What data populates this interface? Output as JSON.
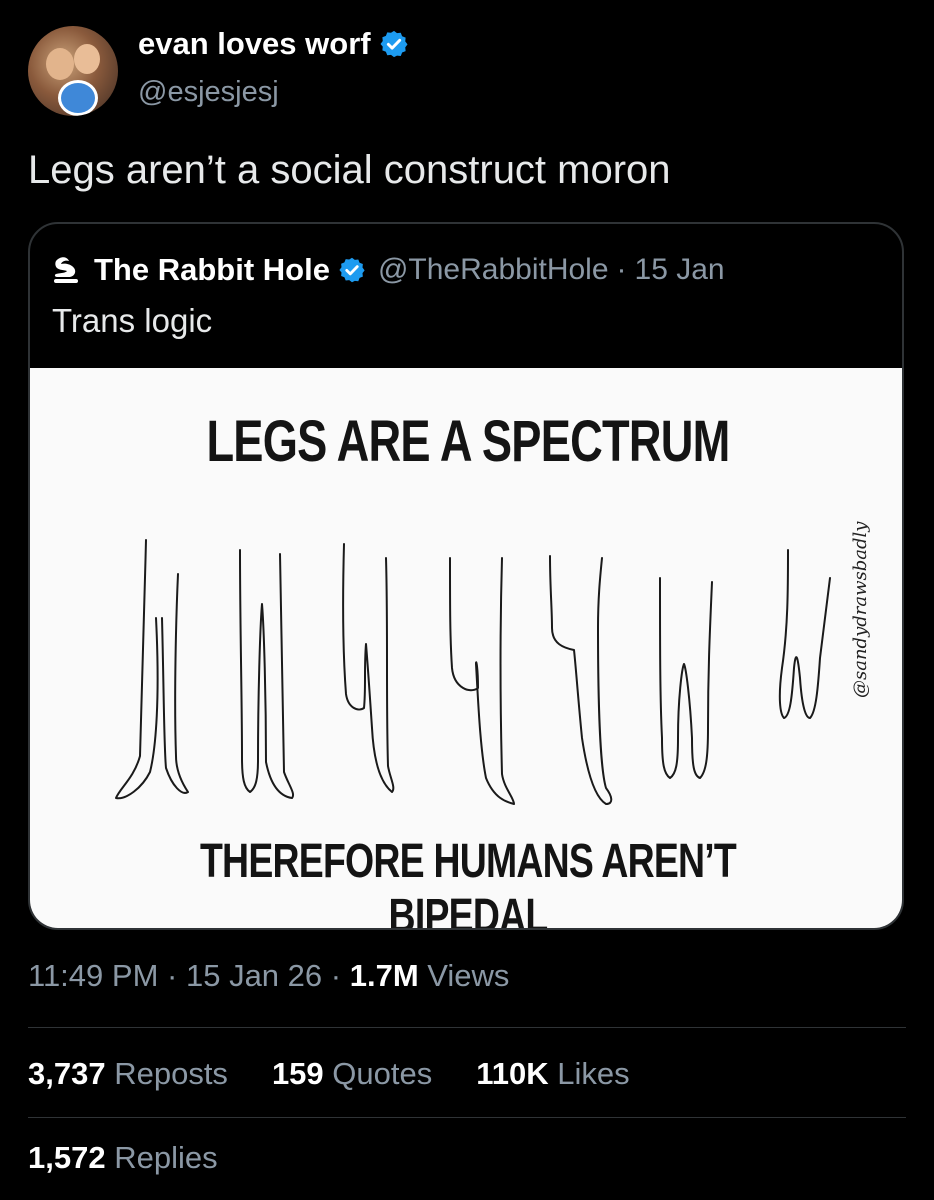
{
  "tweet": {
    "author": {
      "display_name": "evan loves worf",
      "handle": "@esjesjesj",
      "verified": true
    },
    "text": "Legs aren’t a social construct moron",
    "time": "11:49 PM",
    "sep": "·",
    "date": "15 Jan 26",
    "views_count": "1.7M",
    "views_label": "Views"
  },
  "quote": {
    "author": {
      "display_name": "The Rabbit Hole",
      "handle": "@TheRabbitHole",
      "verified": true
    },
    "sep": "·",
    "date": "15 Jan",
    "text": "Trans logic",
    "media": {
      "top_text": "LEGS ARE A SPECTRUM",
      "bottom_text": "THEREFORE HUMANS AREN’T BIPEDAL",
      "signature": "@sandydrawsbadly"
    }
  },
  "stats": {
    "reposts": {
      "count": "3,737",
      "label": "Reposts"
    },
    "quotes": {
      "count": "159",
      "label": "Quotes"
    },
    "likes": {
      "count": "110K",
      "label": "Likes"
    },
    "replies": {
      "count": "1,572",
      "label": "Replies"
    }
  },
  "colors": {
    "background": "#000000",
    "verified": "#1d9bf0",
    "muted": "#8b98a5",
    "text": "#e7e9ea"
  },
  "icons": [
    "verified-badge-icon",
    "rabbit-logo-icon"
  ]
}
